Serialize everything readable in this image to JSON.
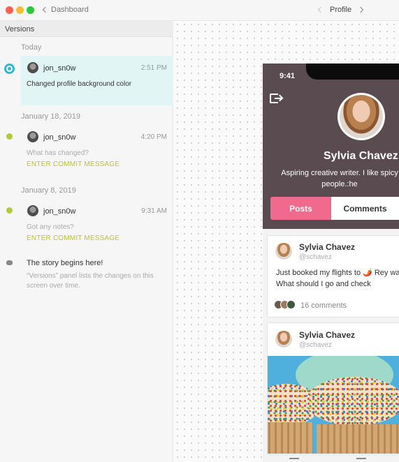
{
  "titlebar": {
    "back_label": "Dashboard",
    "profile_label": "Profile"
  },
  "sidebar": {
    "header": "Versions",
    "groups": [
      {
        "date": "Today",
        "entry": {
          "user": "jon_sn0w",
          "time": "2:51 PM",
          "message": "Changed profile background color"
        }
      },
      {
        "date": "January 18, 2019",
        "entry": {
          "user": "jon_sn0w",
          "time": "4:20 PM",
          "placeholder": "What has changed?",
          "commit_link": "ENTER COMMIT MESSAGE"
        }
      },
      {
        "date": "January 8, 2019",
        "entry": {
          "user": "jon_sn0w",
          "time": "9:31 AM",
          "placeholder": "Got any notes?",
          "commit_link": "ENTER COMMIT MESSAGE"
        }
      }
    ],
    "story": {
      "title": "The story begins here!",
      "description": "“Versions” panel lists the changes on this screen over time."
    }
  },
  "phone": {
    "time": "9:41",
    "name": "Sylvia Chavez",
    "bio": "Aspiring creative writer. I like spicy people.:he",
    "tabs": [
      "Posts",
      "Comments"
    ],
    "posts": [
      {
        "name": "Sylvia Chavez",
        "handle": "@schavez",
        "text": "Just booked my flights to 🌶️ Rey wait! What should I go and check",
        "comments": "16 comments"
      },
      {
        "name": "Sylvia Chavez",
        "handle": "@schavez"
      }
    ]
  },
  "colors": {
    "accent_teal": "#34b6d8",
    "commit_green": "#bec238",
    "posts_tab_pink": "#f06a8d",
    "profile_bg": "#5a4b50"
  }
}
